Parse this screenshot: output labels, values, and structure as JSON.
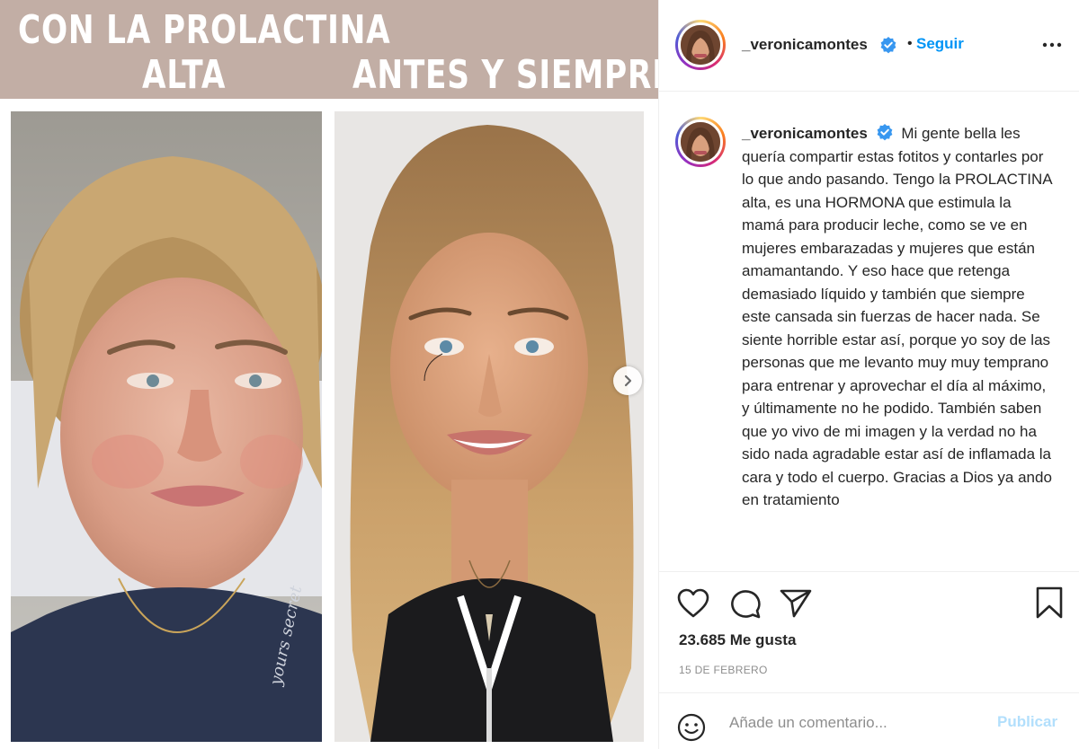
{
  "post_image": {
    "banner_left_line1": "CON LA PROLACTINA",
    "banner_left_line2": "ALTA",
    "banner_right": "ANTES Y SIEMPRE",
    "watermark_text": "yours secret"
  },
  "header": {
    "username": "_veronicamontes",
    "separator": "•",
    "follow_label": "Seguir"
  },
  "caption": {
    "username": "_veronicamontes",
    "text": "Mi gente bella les quería compartir estas fotitos y contarles por lo que ando pasando. Tengo la PROLACTINA alta, es una HORMONA que estimula la mamá para producir leche, como se ve en mujeres embarazadas y mujeres que están amamantando. Y eso hace que retenga demasiado líquido y también que siempre este cansada sin fuerzas de hacer nada. Se siente horrible estar así, porque yo soy de las personas que me levanto muy muy temprano para entrenar y aprovechar el día al máximo, y últimamente no he podido. También saben que yo vivo de mi imagen y la verdad no ha sido nada agradable estar así de inflamada la cara y todo el cuerpo. Gracias a Dios ya ando en tratamiento"
  },
  "stats": {
    "likes": "23.685 Me gusta",
    "date": "15 DE FEBRERO"
  },
  "comment_bar": {
    "placeholder": "Añade un comentario...",
    "publish_label": "Publicar"
  },
  "colors": {
    "banner": "#c2aea5",
    "link_blue": "#0095f6",
    "publish_disabled": "#b2dffc",
    "verified_blue": "#3897f0"
  },
  "icons": {
    "like": "heart-icon",
    "comment": "comment-icon",
    "share": "paper-plane-icon",
    "save": "bookmark-icon",
    "emoji": "smiley-icon",
    "more": "ellipsis-icon",
    "next": "chevron-right-icon",
    "verified": "verified-badge-icon"
  }
}
